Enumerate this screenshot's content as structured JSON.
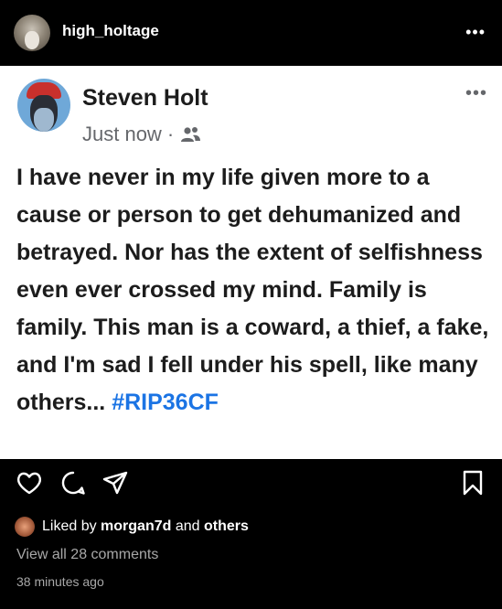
{
  "header": {
    "username": "high_holtage",
    "more_label": "•••"
  },
  "post": {
    "author": "Steven Holt",
    "timestamp": "Just now",
    "separator": "·",
    "body_text": "I have never in my life given more to a cause or person to get dehumanized and betrayed. Nor has the extent of selfishness even ever crossed my mind. Family is family. This man is a coward, a thief, a fake, and I'm sad I fell under his spell, like many others... ",
    "hashtag": "#RIP36CF",
    "more_label": "•••",
    "audience_icon": "friends-icon"
  },
  "actions": {
    "icons": [
      "heart-icon",
      "comment-icon",
      "share-icon",
      "bookmark-icon"
    ]
  },
  "likes": {
    "prefix": "Liked by",
    "user": "morgan7d",
    "and": "and",
    "others": "others"
  },
  "comments": {
    "view_all": "View all 28 comments"
  },
  "posted": "38 minutes ago",
  "colors": {
    "background": "#000000",
    "card": "#ffffff",
    "hashtag": "#1b74e4",
    "muted": "#a8a8a8"
  }
}
